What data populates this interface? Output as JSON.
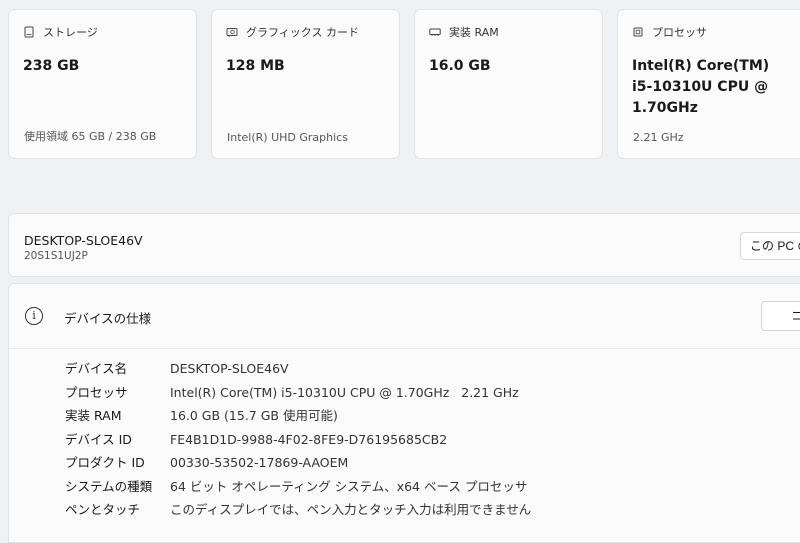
{
  "cards": [
    {
      "icon": "storage-icon",
      "label": "ストレージ",
      "value": "238 GB",
      "sub": "使用領域 65 GB / 238 GB"
    },
    {
      "icon": "graphics-card-icon",
      "label": "グラフィックス カード",
      "value": "128 MB",
      "sub": "Intel(R) UHD Graphics"
    },
    {
      "icon": "ram-icon",
      "label": "実装 RAM",
      "value": "16.0 GB",
      "sub": ""
    },
    {
      "icon": "processor-icon",
      "label": "プロセッサ",
      "value_lines": [
        "Intel(R) Core(TM)",
        "i5-10310U CPU @",
        "1.70GHz"
      ],
      "sub": "2.21 GHz"
    }
  ],
  "device": {
    "name": "DESKTOP-SLOE46V",
    "model": "20S1S1UJ2P",
    "rename_label": "この PC の名前を変更"
  },
  "specs": {
    "title": "デバイスの仕様",
    "copy_label": "コピー",
    "rows": [
      {
        "label": "デバイス名",
        "value": "DESKTOP-SLOE46V"
      },
      {
        "label": "プロセッサ",
        "value": "Intel(R) Core(TM) i5-10310U CPU @ 1.70GHz   2.21 GHz"
      },
      {
        "label": "実装 RAM",
        "value": "16.0 GB (15.7 GB 使用可能)"
      },
      {
        "label": "デバイス ID",
        "value": "FE4B1D1D-9988-4F02-8FE9-D76195685CB2"
      },
      {
        "label": "プロダクト ID",
        "value": "00330-53502-17869-AAOEM"
      },
      {
        "label": "システムの種類",
        "value": "64 ビット オペレーティング システム、x64 ベース プロセッサ"
      },
      {
        "label": "ペンとタッチ",
        "value": "このディスプレイでは、ペン入力とタッチ入力は利用できません"
      }
    ]
  }
}
